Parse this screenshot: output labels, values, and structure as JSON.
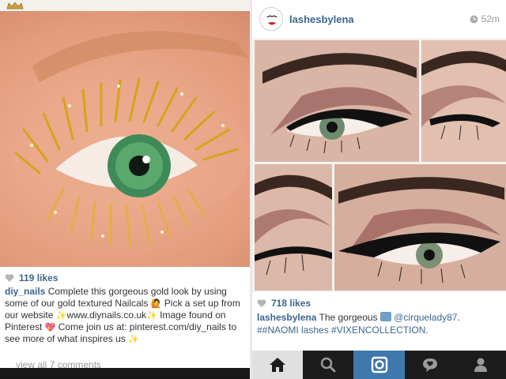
{
  "left_post": {
    "likes": "119 likes",
    "caption_user": "diy_nails",
    "caption_part1": " Complete this gorgeous gold look by using some of our gold textured Nailcals ",
    "caption_part2": " Pick a set up from our website ",
    "caption_part3": "www.diynails.co.uk",
    "caption_part4": " Image found on Pinterest ",
    "caption_part5": " Come join us at: pinterest.com/diy_nails to see more of what inspires us ",
    "view_comments": "view all 7 comments"
  },
  "right_post": {
    "username": "lashesbylena",
    "time": "52m",
    "likes": "718 likes",
    "caption_user": "lashesbylena",
    "caption_part1": " The gorgeous ",
    "caption_mention": "@cirquelady87",
    "caption_part2": ".",
    "caption_tags": "##NAOMI lashes #VIXENCOLLECTION."
  },
  "icons": {
    "left_top": "crown-icon",
    "like": "heart-icon",
    "time": "clock-icon",
    "tabs": [
      "home-icon",
      "search-icon",
      "camera-icon",
      "activity-icon",
      "profile-icon"
    ]
  },
  "colors": {
    "link": "#3b6590",
    "tabbar": "#1c1c1c",
    "camera_tab": "#3f78ad"
  }
}
